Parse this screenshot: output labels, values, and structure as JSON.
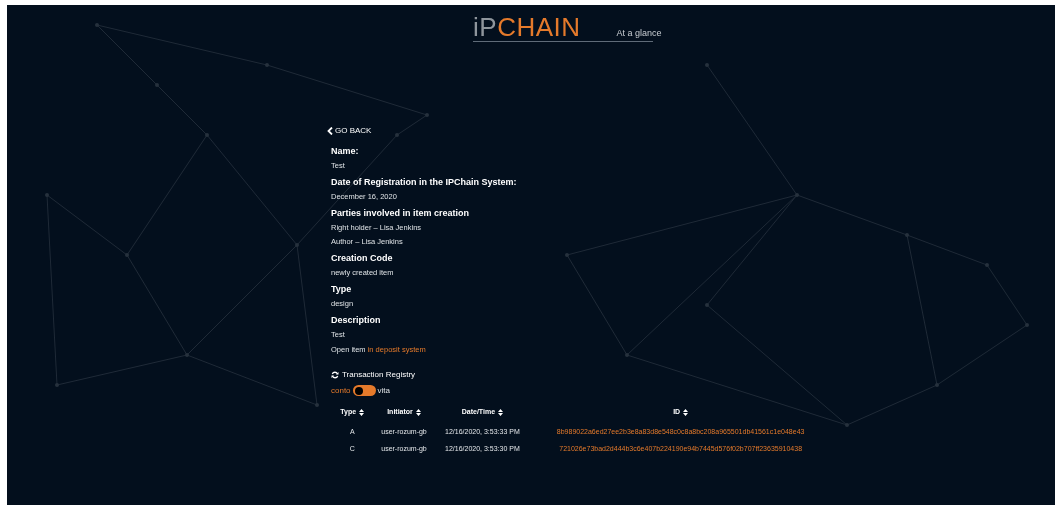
{
  "header": {
    "logo_prefix": "iP",
    "logo_main": "CHAIN",
    "tagline": "At a glance"
  },
  "back_link": "GO BACK",
  "fields": [
    {
      "label": "Name:",
      "values": [
        "Test"
      ]
    },
    {
      "label": "Date of Registration in the IPChain System:",
      "values": [
        "December 16, 2020"
      ]
    },
    {
      "label": "Parties involved in item creation",
      "values": [
        "Right holder – Lisa Jenkins",
        "Author – Lisa Jenkins"
      ]
    },
    {
      "label": "Creation Code",
      "values": [
        "newly created item"
      ]
    },
    {
      "label": "Type",
      "values": [
        "design"
      ]
    },
    {
      "label": "Description",
      "values": [
        "Test"
      ]
    }
  ],
  "open_item": {
    "text": "Open item",
    "link": "in deposit system"
  },
  "registry": {
    "title": "Transaction Registry",
    "toggle": {
      "left_label": "conto",
      "right_label": "vita",
      "on": false
    }
  },
  "table": {
    "columns": [
      "Type",
      "Initiator",
      "Date/Time",
      "ID"
    ],
    "rows": [
      {
        "type": "A",
        "initiator": "user-rozum-gb",
        "datetime": "12/16/2020, 3:53:33 PM",
        "id": "8b989022a6ed27ee2b3e8a83d8e548c0c8a8bc208a965501db41561c1e048e43"
      },
      {
        "type": "C",
        "initiator": "user-rozum-gb",
        "datetime": "12/16/2020, 3:53:30 PM",
        "id": "721026e73bad2d444b3c6e407b224190e94b7445d576f02b707ff23635910438"
      }
    ]
  }
}
